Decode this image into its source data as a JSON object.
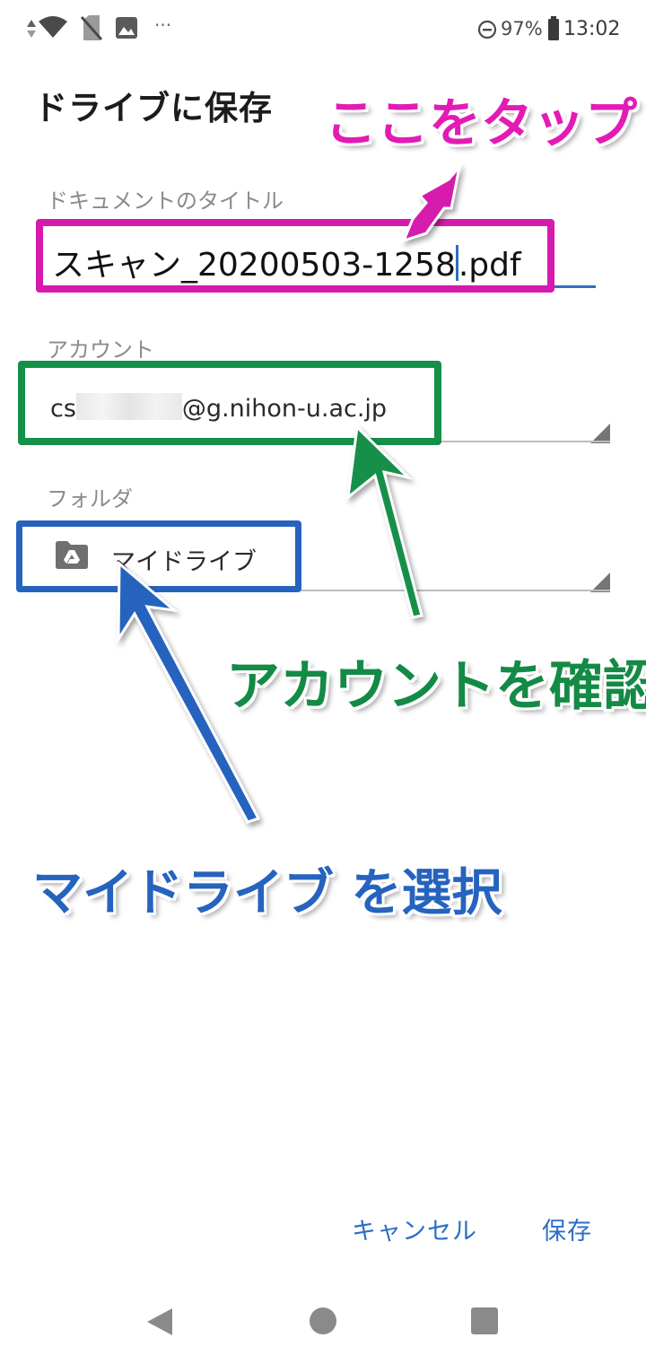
{
  "status_bar": {
    "battery_percent": "97%",
    "time": "13:02",
    "more_indicator": "···"
  },
  "dialog": {
    "title": "ドライブに保存",
    "doc_title": {
      "label": "ドキュメントのタイトル",
      "value_before_cursor": "スキャン_20200503-1258",
      "value_after_cursor": ".pdf"
    },
    "account": {
      "label": "アカウント",
      "prefix": "cs",
      "suffix": "@g.nihon-u.ac.jp"
    },
    "folder": {
      "label": "フォルダ",
      "value": "マイドライブ"
    },
    "buttons": {
      "cancel": "キャンセル",
      "save": "保存"
    }
  },
  "annotations": {
    "tap_here": {
      "text": "ここをタップ",
      "color": "#e31bb4"
    },
    "check_account": {
      "text": "アカウントを確認",
      "color": "#138a45"
    },
    "select_mydrive": {
      "text": "マイドライブ を選択",
      "color": "#2563be"
    }
  },
  "colors": {
    "accent_blue": "#2a6fc6",
    "box_magenta": "#d61aad",
    "box_green": "#149048",
    "box_blue": "#2563be"
  }
}
